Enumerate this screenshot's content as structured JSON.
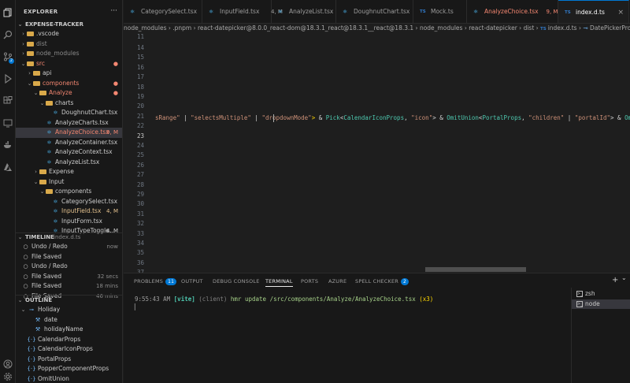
{
  "activity_bar": {
    "icons": [
      "files-icon",
      "search-icon",
      "source-control-icon",
      "run-debug-icon",
      "extensions-icon",
      "remote-explorer-icon",
      "docker-icon",
      "azure-icon",
      "account-icon",
      "settings-gear-icon"
    ]
  },
  "explorer": {
    "title": "EXPLORER",
    "more": "···",
    "project": "EXPENSE-TRACKER",
    "items": [
      {
        "label": ".vscode",
        "indent": 1,
        "type": "folder",
        "twisty": "›",
        "color": "#cccccc",
        "right": ""
      },
      {
        "label": "dist",
        "indent": 1,
        "type": "folder",
        "twisty": "›",
        "color": "#8b8b8b",
        "right": ""
      },
      {
        "label": "node_modules",
        "indent": 1,
        "type": "folder",
        "twisty": "›",
        "color": "#8b8b8b",
        "right": ""
      },
      {
        "label": "src",
        "indent": 1,
        "type": "folder",
        "twisty": "⌄",
        "color": "#f48771",
        "right": "●"
      },
      {
        "label": "api",
        "indent": 2,
        "type": "folder",
        "twisty": "›",
        "color": "#cccccc",
        "right": ""
      },
      {
        "label": "components",
        "indent": 2,
        "type": "folder",
        "twisty": "⌄",
        "color": "#f48771",
        "right": "●"
      },
      {
        "label": "Analyze",
        "indent": 3,
        "type": "folder",
        "twisty": "⌄",
        "color": "#f48771",
        "right": "●"
      },
      {
        "label": "charts",
        "indent": 4,
        "type": "folder",
        "twisty": "⌄",
        "color": "#cccccc",
        "right": ""
      },
      {
        "label": "DoughnutChart.tsx",
        "indent": 5,
        "type": "react",
        "twisty": "",
        "color": "#cccccc",
        "right": ""
      },
      {
        "label": "AnalyzeCharts.tsx",
        "indent": 4,
        "type": "react",
        "twisty": "",
        "color": "#cccccc",
        "right": ""
      },
      {
        "label": "AnalyzeChoice.tsx",
        "indent": 4,
        "type": "react",
        "twisty": "",
        "color": "#f48771",
        "right": "9, M",
        "selected": true
      },
      {
        "label": "AnalyzeContainer.tsx",
        "indent": 4,
        "type": "react",
        "twisty": "",
        "color": "#cccccc",
        "right": ""
      },
      {
        "label": "AnalyzeContext.tsx",
        "indent": 4,
        "type": "react",
        "twisty": "",
        "color": "#cccccc",
        "right": ""
      },
      {
        "label": "AnalyzeList.tsx",
        "indent": 4,
        "type": "react",
        "twisty": "",
        "color": "#cccccc",
        "right": ""
      },
      {
        "label": "Expense",
        "indent": 3,
        "type": "folder",
        "twisty": "›",
        "color": "#cccccc",
        "right": ""
      },
      {
        "label": "Input",
        "indent": 3,
        "type": "folder",
        "twisty": "⌄",
        "color": "#cccccc",
        "right": ""
      },
      {
        "label": "components",
        "indent": 4,
        "type": "folder",
        "twisty": "⌄",
        "color": "#cccccc",
        "right": ""
      },
      {
        "label": "CategorySelect.tsx",
        "indent": 5,
        "type": "react",
        "twisty": "",
        "color": "#cccccc",
        "right": ""
      },
      {
        "label": "InputField.tsx",
        "indent": 5,
        "type": "react",
        "twisty": "",
        "color": "#e2c08d",
        "right": "4, M"
      },
      {
        "label": "InputForm.tsx",
        "indent": 5,
        "type": "react",
        "twisty": "",
        "color": "#cccccc",
        "right": ""
      },
      {
        "label": "InputTypeToggle...",
        "indent": 5,
        "type": "react",
        "twisty": "",
        "color": "#cccccc",
        "right": "4, M"
      }
    ]
  },
  "timeline": {
    "title": "TIMELINE",
    "file": "index.d.ts",
    "items": [
      {
        "label": "Undo / Redo",
        "time": "now"
      },
      {
        "label": "File Saved",
        "time": ""
      },
      {
        "label": "Undo / Redo",
        "time": ""
      },
      {
        "label": "File Saved",
        "time": "32 secs"
      },
      {
        "label": "File Saved",
        "time": "18 mins"
      },
      {
        "label": "File Saved",
        "time": "46 mins"
      }
    ]
  },
  "outline": {
    "title": "OUTLINE",
    "items": [
      {
        "label": "Holiday",
        "indent": 1,
        "icon": "⊸",
        "twisty": "⌄"
      },
      {
        "label": "date",
        "indent": 2,
        "icon": "⚒",
        "twisty": ""
      },
      {
        "label": "holidayName",
        "indent": 2,
        "icon": "⚒",
        "twisty": ""
      },
      {
        "label": "CalendarProps",
        "indent": 1,
        "icon": "{·}",
        "twisty": ""
      },
      {
        "label": "CalendarIconProps",
        "indent": 1,
        "icon": "{·}",
        "twisty": ""
      },
      {
        "label": "PortalProps",
        "indent": 1,
        "icon": "{·}",
        "twisty": ""
      },
      {
        "label": "PopperComponentProps",
        "indent": 1,
        "icon": "{·}",
        "twisty": ""
      },
      {
        "label": "OmitUnion",
        "indent": 1,
        "icon": "{·}",
        "twisty": ""
      }
    ]
  },
  "tabs": [
    {
      "label": "CategorySelect.tsx",
      "suffix": "",
      "icon": "⚛",
      "active": false,
      "color": "#9d9d9d"
    },
    {
      "label": "InputField.tsx",
      "suffix": "4, M",
      "icon": "⚛",
      "active": false,
      "color": "#9d9d9d"
    },
    {
      "label": "AnalyzeList.tsx",
      "suffix": "",
      "icon": "⚛",
      "active": false,
      "color": "#9d9d9d"
    },
    {
      "label": "DoughnutChart.tsx",
      "suffix": "",
      "icon": "⚛",
      "active": false,
      "color": "#9d9d9d"
    },
    {
      "label": "Mock.ts",
      "suffix": "",
      "icon": "TS",
      "active": false,
      "color": "#9d9d9d"
    },
    {
      "label": "AnalyzeChoice.tsx",
      "suffix": "9, M",
      "icon": "⚛",
      "active": false,
      "color": "#f48771"
    },
    {
      "label": "index.d.ts",
      "suffix": "",
      "icon": "TS",
      "active": true,
      "color": "#ffffff"
    }
  ],
  "breadcrumbs": [
    "node_modules",
    ".pnpm",
    "react-datepicker@8.0.0_react-dom@18.3.1_react@18.3.1__react@18.3.1",
    "node_modules",
    "react-datepicker",
    "dist",
    "index.d.ts",
    "DatePickerProps"
  ],
  "editor": {
    "line_numbers": [
      "11",
      "",
      "14",
      "15",
      "16",
      "17",
      "18",
      "19",
      "20",
      "21",
      "22",
      "23",
      "24",
      "25",
      "26",
      "27",
      "28",
      "29",
      "30",
      "31",
      "32",
      "33",
      "34",
      "35",
      "36",
      "37",
      "38",
      "39",
      "40",
      "41"
    ],
    "current_line": "23",
    "code_tokens": [
      {
        "text": "sRange\"",
        "cls": "s"
      },
      {
        "text": " | ",
        "cls": "p"
      },
      {
        "text": "\"selectsMultiple\"",
        "cls": "s"
      },
      {
        "text": " | ",
        "cls": "p"
      },
      {
        "text": "\"dropdownMode\"",
        "cls": "s"
      },
      {
        "text": ">",
        "cls": "y"
      },
      {
        "text": " & ",
        "cls": "p"
      },
      {
        "text": "Pick",
        "cls": "t"
      },
      {
        "text": "<",
        "cls": "p"
      },
      {
        "text": "CalendarIconProps",
        "cls": "t"
      },
      {
        "text": ", ",
        "cls": "p"
      },
      {
        "text": "\"icon\"",
        "cls": "s"
      },
      {
        "text": "> & ",
        "cls": "p"
      },
      {
        "text": "OmitUnion",
        "cls": "t"
      },
      {
        "text": "<",
        "cls": "p"
      },
      {
        "text": "PortalProps",
        "cls": "t"
      },
      {
        "text": ", ",
        "cls": "p"
      },
      {
        "text": "\"children\"",
        "cls": "s"
      },
      {
        "text": " | ",
        "cls": "p"
      },
      {
        "text": "\"portalId\"",
        "cls": "s"
      },
      {
        "text": "> & ",
        "cls": "p"
      },
      {
        "text": "Omit",
        "cls": "t"
      },
      {
        "text": "<",
        "cls": "p"
      },
      {
        "text": "Popper",
        "cls": "t"
      }
    ]
  },
  "panel": {
    "tabs": [
      {
        "label": "PROBLEMS",
        "badge": "11",
        "active": false
      },
      {
        "label": "OUTPUT",
        "badge": "",
        "active": false
      },
      {
        "label": "DEBUG CONSOLE",
        "badge": "",
        "active": false
      },
      {
        "label": "TERMINAL",
        "badge": "",
        "active": true
      },
      {
        "label": "PORTS",
        "badge": "",
        "active": false
      },
      {
        "label": "AZURE",
        "badge": "",
        "active": false
      },
      {
        "label": "SPELL CHECKER",
        "badge": "2",
        "active": false
      }
    ],
    "terminal": {
      "time": "9:55:43 AM",
      "tag": "[vite]",
      "client": "(client)",
      "message": "hmr update /src/components/Analyze/AnalyzeChoice.tsx",
      "count": "(x3)",
      "cursor": "▏"
    },
    "terminals": [
      {
        "label": "zsh",
        "selected": false
      },
      {
        "label": "node",
        "selected": true
      }
    ],
    "add_icon": "+",
    "dropdown_icon": "⌄"
  }
}
